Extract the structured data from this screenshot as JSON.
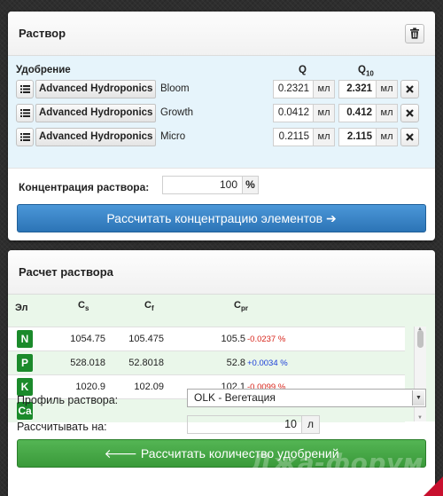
{
  "solution_panel": {
    "title": "Раствор",
    "headers": {
      "fertilizer": "Удобрение",
      "q": "Q",
      "q10_main": "Q",
      "q10_sub": "10"
    },
    "rows": [
      {
        "brand": "Advanced Hydroponics",
        "name": "Bloom",
        "q": "0.2321",
        "q_unit": "мл",
        "q10": "2.321",
        "q10_unit": "мл"
      },
      {
        "brand": "Advanced Hydroponics",
        "name": "Growth",
        "q": "0.0412",
        "q_unit": "мл",
        "q10": "0.412",
        "q10_unit": "мл"
      },
      {
        "brand": "Advanced Hydroponics",
        "name": "Micro",
        "q": "0.2115",
        "q_unit": "мл",
        "q10": "2.115",
        "q10_unit": "мл"
      }
    ],
    "concentration_label": "Концентрация раствора:",
    "concentration_value": "100",
    "concentration_unit": "%",
    "calc_button": "Рассчитать концентрацию элементов ➔"
  },
  "calc_panel": {
    "title": "Расчет раствора",
    "headers": {
      "el": "Эл",
      "cs": "C",
      "cs_sub": "s",
      "cf": "C",
      "cf_sub": "f",
      "cpr": "C",
      "cpr_sub": "pr"
    },
    "rows": [
      {
        "el": "N",
        "cs": "1054.75",
        "cf": "105.475",
        "cpr": "105.5",
        "dev": "-0.0237 %",
        "dev_sign": "neg"
      },
      {
        "el": "P",
        "cs": "528.018",
        "cf": "52.8018",
        "cpr": "52.8",
        "dev": "+0.0034 %",
        "dev_sign": "pos"
      },
      {
        "el": "K",
        "cs": "1020.9",
        "cf": "102.09",
        "cpr": "102.1",
        "dev": "-0.0099 %",
        "dev_sign": "neg"
      },
      {
        "el": "Ca",
        "cs": "",
        "cf": "",
        "cpr": "",
        "dev": "",
        "dev_sign": "neg"
      }
    ],
    "profile_label": "Профиль раствора:",
    "profile_value": "OLK - Вегетация",
    "calc_for_label": "Рассчитывать на:",
    "calc_for_value": "10",
    "calc_for_unit": "л",
    "calc_button": "🡐 Рассчитать количество удобрений"
  },
  "watermark": "Джа-форум",
  "colors": {
    "blue_button": "#2c74b6",
    "green_button": "#3a9a3a",
    "badge_green": "#1b8a2b",
    "negative": "#d8261c",
    "positive": "#1c3fd8"
  }
}
